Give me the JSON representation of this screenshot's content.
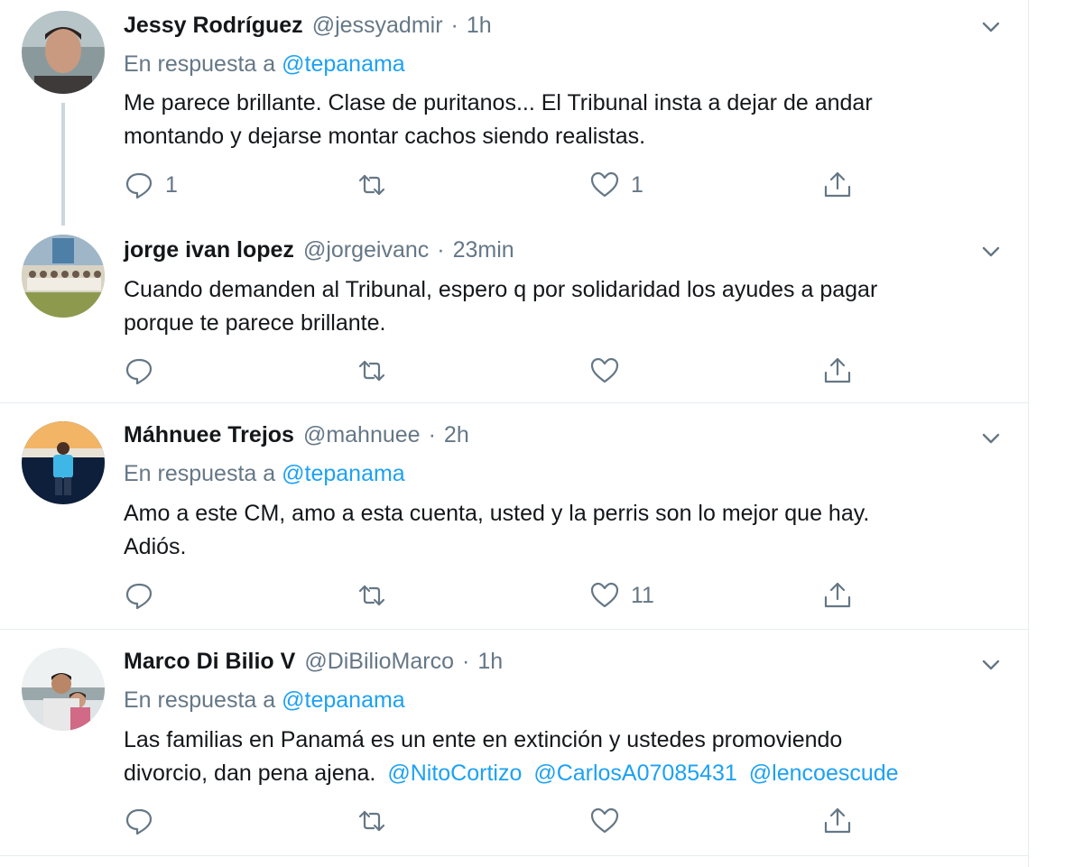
{
  "tweets": [
    {
      "name": "Jessy Rodríguez",
      "handle": "@jessyadmir",
      "dot": "·",
      "time": "1h",
      "reply_prefix": "En respuesta a",
      "reply_to": "@tepanama",
      "text_lines": [
        "Me parece brillante. Clase de puritanos... El Tribunal insta a dejar de andar",
        "montando y dejarse montar cachos siendo realistas."
      ],
      "reply_count": "1",
      "retweet_count": "",
      "like_count": "1"
    },
    {
      "name": "jorge ivan lopez",
      "handle": "@jorgeivanc",
      "dot": "·",
      "time": "23min",
      "text_lines": [
        "Cuando demanden al Tribunal, espero q por solidaridad los ayudes a pagar",
        "porque te parece brillante."
      ],
      "reply_count": "",
      "retweet_count": "",
      "like_count": ""
    },
    {
      "name": "Máhnuee Trejos",
      "handle": "@mahnuee",
      "dot": "·",
      "time": "2h",
      "reply_prefix": "En respuesta a",
      "reply_to": "@tepanama",
      "text_lines": [
        "Amo a este CM, amo a esta cuenta, usted y la perris son lo mejor que hay.",
        "Adiós."
      ],
      "reply_count": "",
      "retweet_count": "",
      "like_count": "11"
    },
    {
      "name": "Marco Di Bilio V",
      "handle": "@DiBilioMarco",
      "dot": "·",
      "time": "1h",
      "reply_prefix": "En respuesta a",
      "reply_to": "@tepanama",
      "text_lines": [
        "Las familias en Panamá es un ente en extinción y ustedes promoviendo",
        "divorcio, dan pena ajena."
      ],
      "mentions": [
        "@NitoCortizo",
        "@CarlosA07085431",
        "@lencoescude"
      ],
      "reply_count": "",
      "retweet_count": "",
      "like_count": ""
    }
  ],
  "icons": {
    "reply": "reply-icon",
    "retweet": "retweet-icon",
    "like": "heart-icon",
    "share": "share-icon",
    "caret": "chevron-down-icon"
  },
  "colors": {
    "link": "#1da1f2",
    "secondary_text": "#657786",
    "primary_text": "#14171a",
    "divider": "#e6ecf0"
  }
}
